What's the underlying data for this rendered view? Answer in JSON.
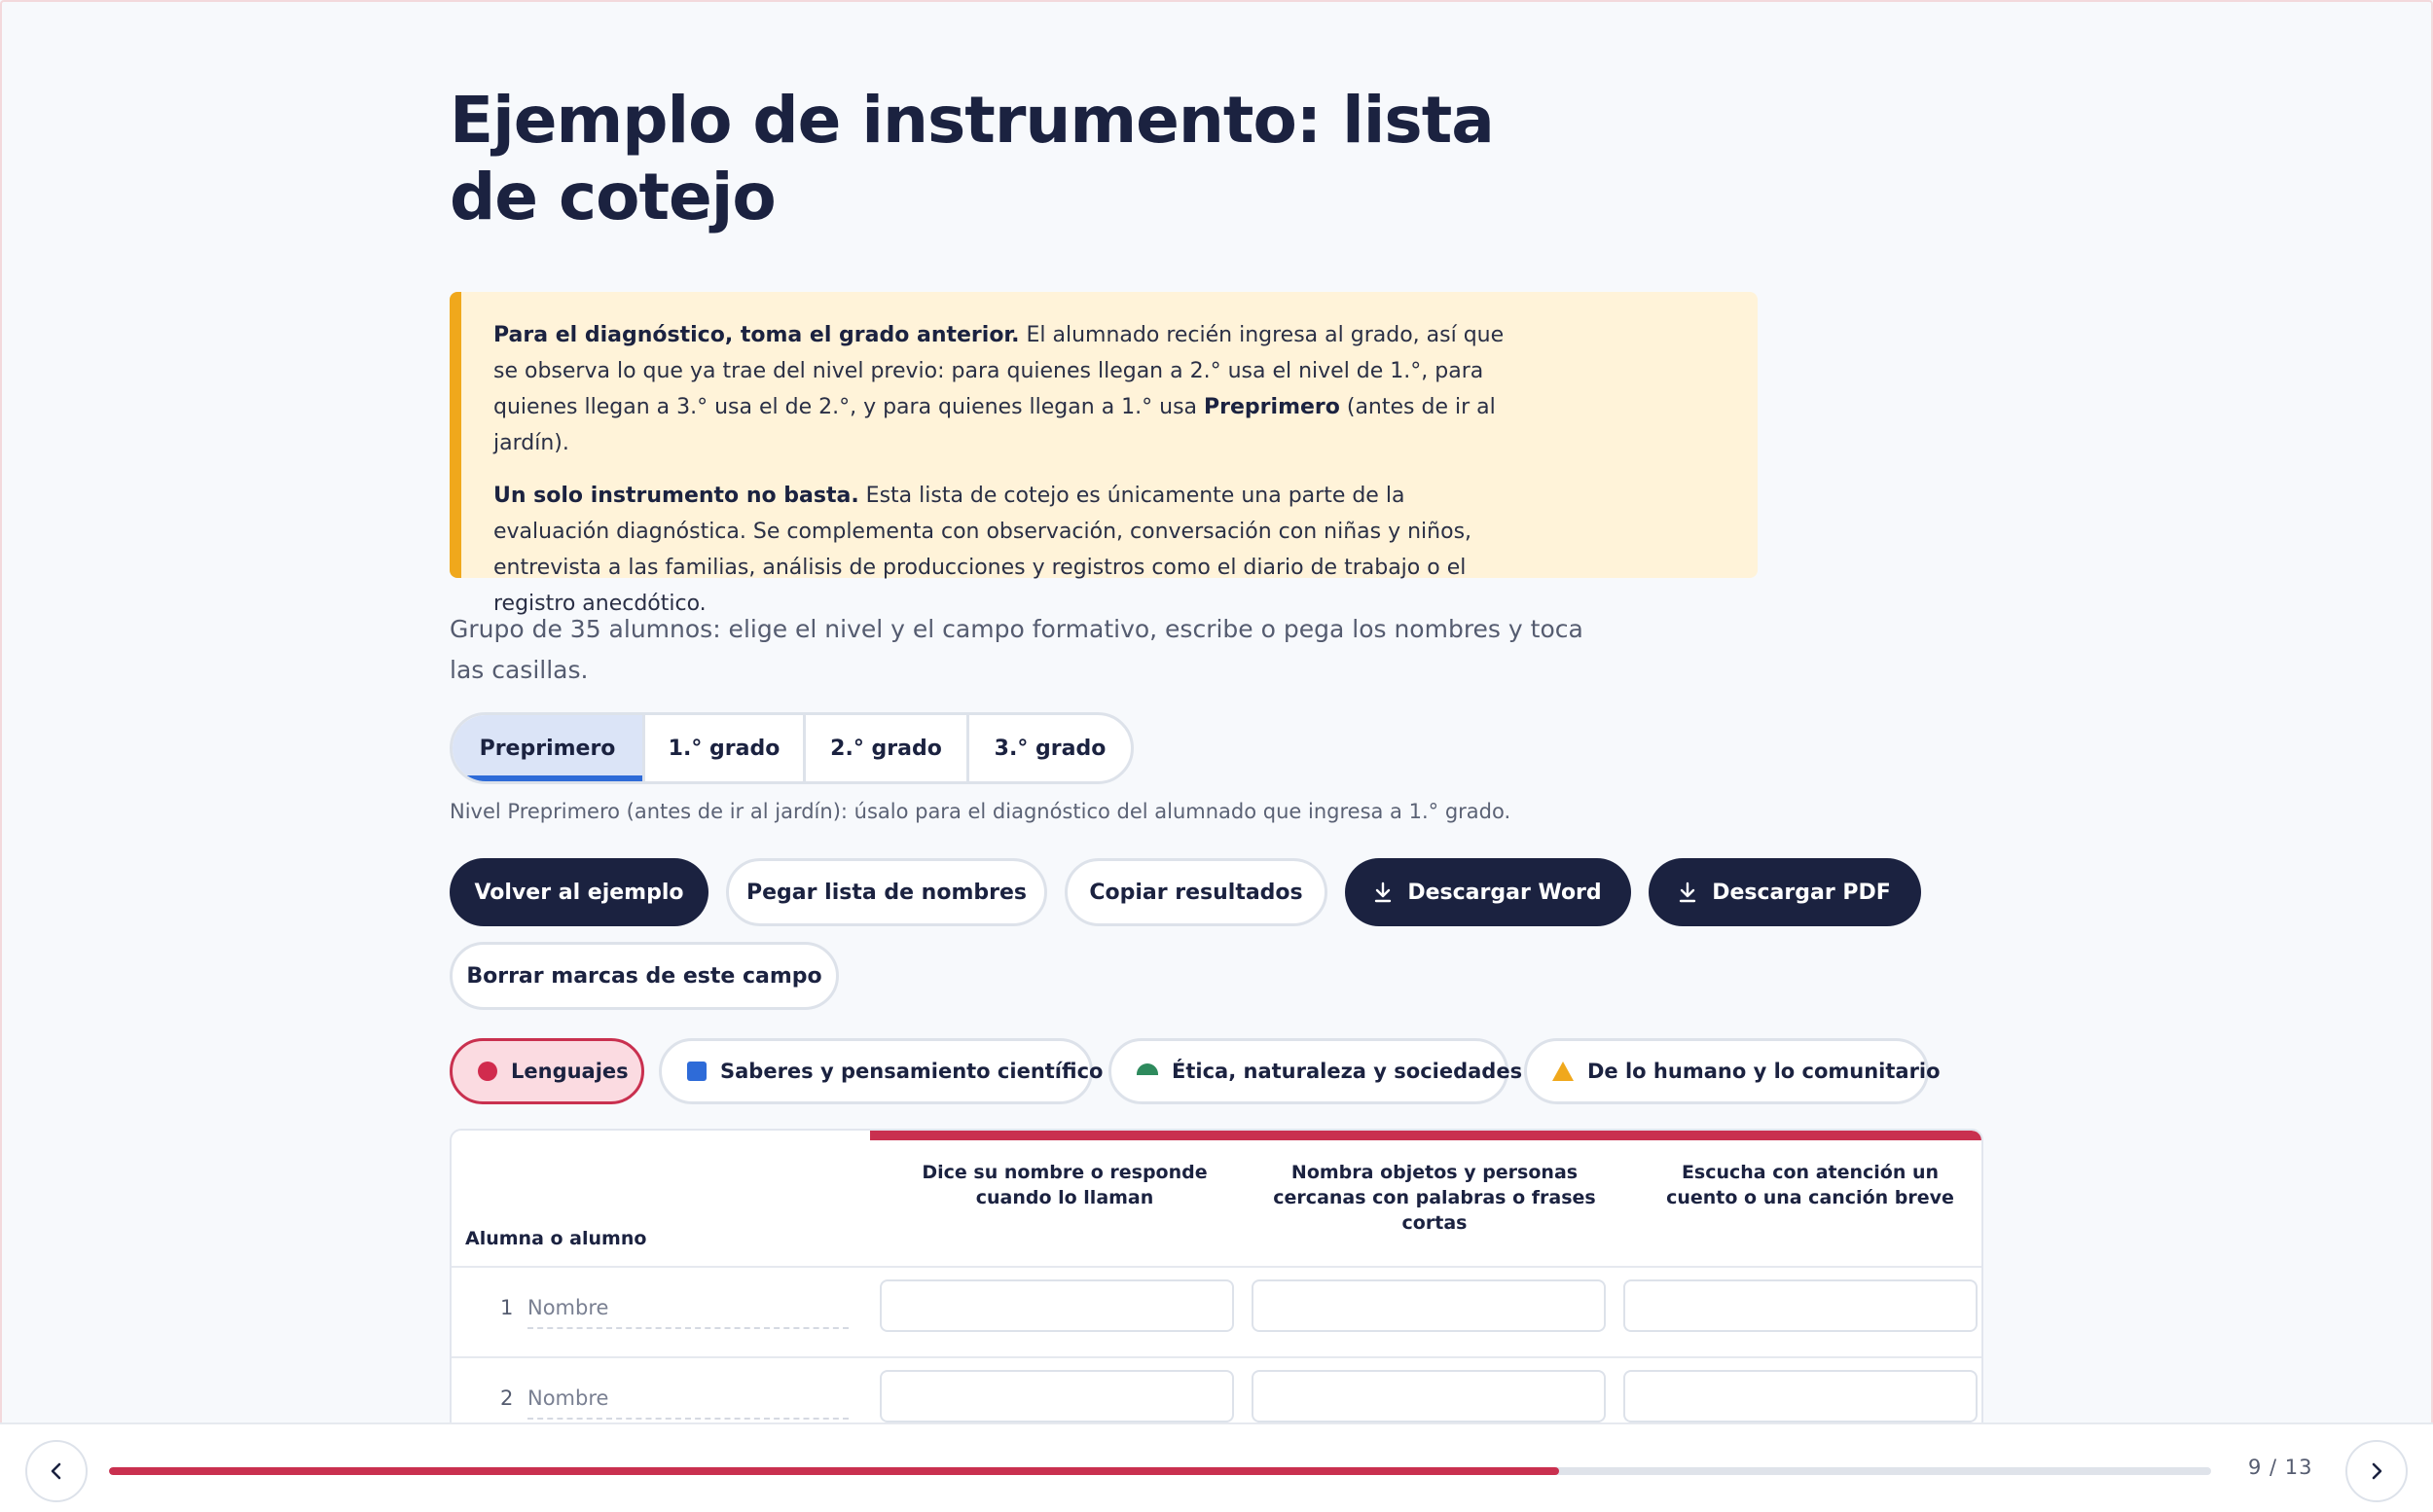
{
  "page": {
    "title": "Ejemplo de instrumento: lista de cotejo"
  },
  "callout": {
    "p1_bold": "Para el diagnóstico, toma el grado anterior.",
    "p1_a": " El alumnado recién ingresa al grado, así que se observa lo que ya trae del nivel previo: para quienes llegan a 2.° usa el nivel de 1.°, para quienes llegan a 3.° usa el de 2.°, y para quienes llegan a 1.° usa ",
    "p1_bold2": "Preprimero",
    "p1_b": " (antes de ir al jardín).",
    "p2_bold": "Un solo instrumento no basta.",
    "p2": " Esta lista de cotejo es únicamente una parte de la evaluación diagnóstica. Se complementa con observación, conversación con niñas y niños, entrevista a las familias, análisis de producciones y registros como el diario de trabajo o el registro anecdótico."
  },
  "intro": "Grupo de 35 alumnos: elige el nivel y el campo formativo, escribe o pega los nombres y toca las casillas.",
  "levels": {
    "selected": "Preprimero",
    "items": [
      "Preprimero",
      "1.° grado",
      "2.° grado",
      "3.° grado"
    ]
  },
  "level_note": "Nivel Preprimero (antes de ir al jardín): úsalo para el diagnóstico del alumnado que ingresa a 1.° grado.",
  "actions": {
    "back": "Volver al ejemplo",
    "paste": "Pegar lista de nombres",
    "copy": "Copiar resultados",
    "word": "Descargar Word",
    "pdf": "Descargar PDF",
    "clear": "Borrar marcas de este campo"
  },
  "fields": {
    "selected": "Lenguajes",
    "items": [
      {
        "label": "Lenguajes",
        "icon": "circle-icon",
        "color": "#d12b4d"
      },
      {
        "label": "Saberes y pensamiento científico",
        "icon": "square-icon",
        "color": "#2e6bd8"
      },
      {
        "label": "Ética, naturaleza y sociedades",
        "icon": "semicircle-icon",
        "color": "#2e8a5d"
      },
      {
        "label": "De lo humano y lo comunitario",
        "icon": "triangle-icon",
        "color": "#f0a81c"
      }
    ]
  },
  "table": {
    "student_header": "Alumna o alumno",
    "criteria": [
      "Dice su nombre o responde cuando lo llaman",
      "Nombra objetos y personas cercanas con palabras o frases cortas",
      "Escucha con atención un cuento o una canción breve"
    ],
    "rows": [
      {
        "num": "1",
        "name_placeholder": "Nombre"
      },
      {
        "num": "2",
        "name_placeholder": "Nombre"
      }
    ]
  },
  "footer": {
    "page_label": "9 / 13",
    "progress": 0.69
  },
  "colors": {
    "accent": "#c9304f",
    "navy": "#1b2240",
    "blue": "#2e6bd8",
    "warning_bg": "#fff3d9",
    "warning_border": "#f0a81c"
  }
}
